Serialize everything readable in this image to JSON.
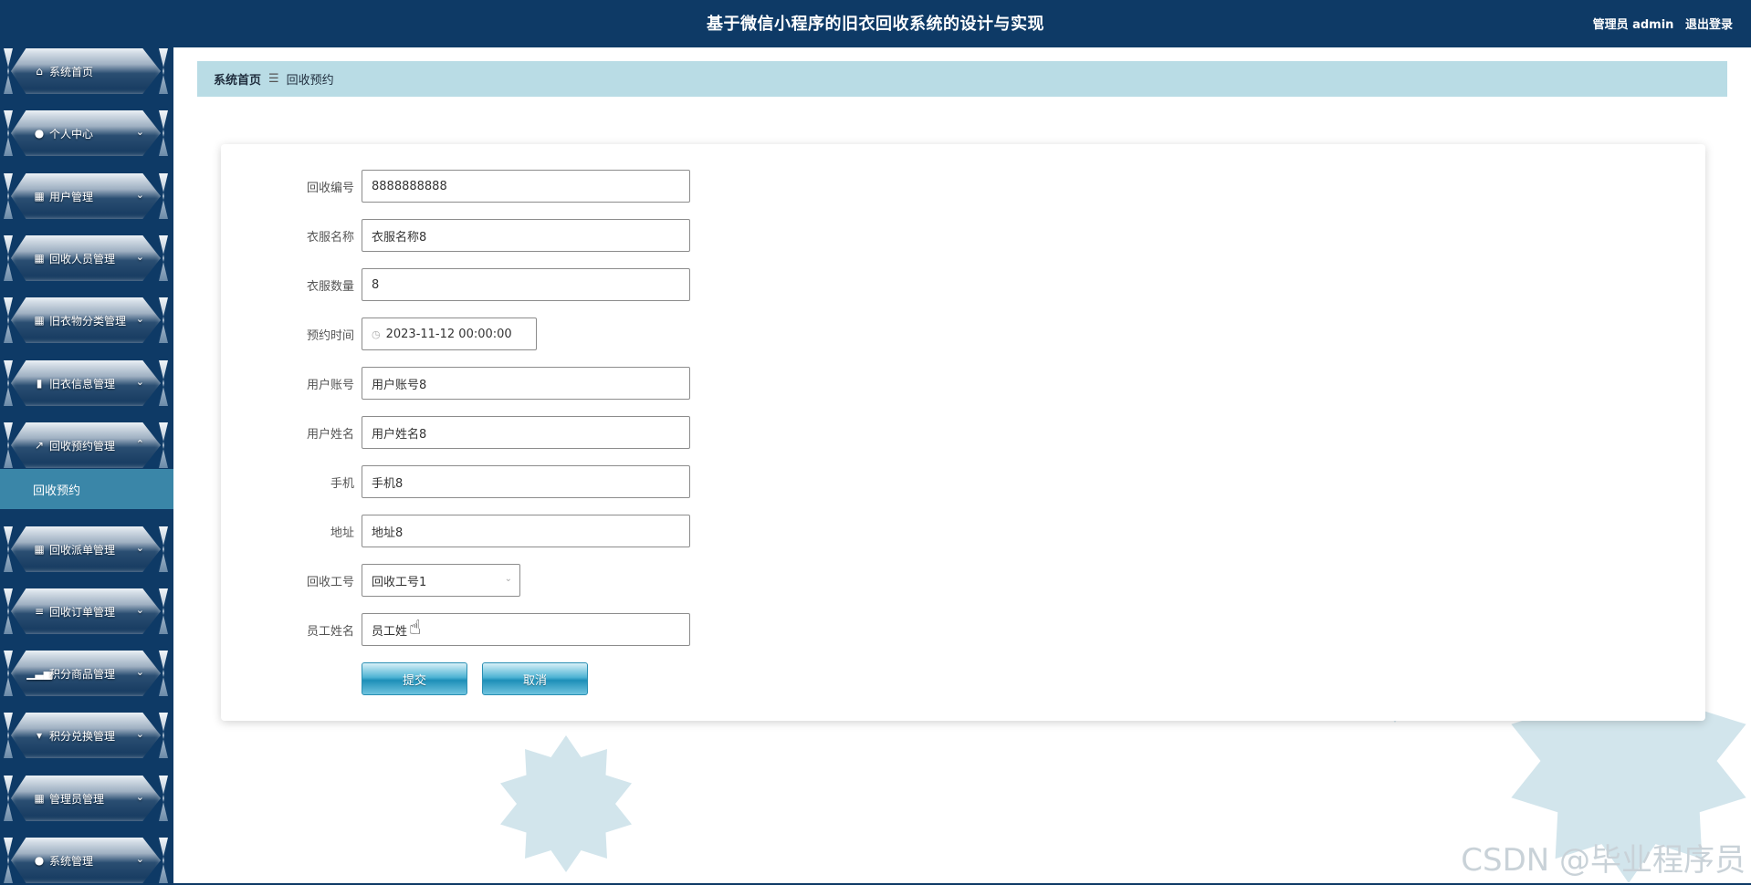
{
  "header": {
    "title": "基于微信小程序的旧衣回收系统的设计与实现",
    "user_label": "管理员 admin",
    "logout_label": "退出登录"
  },
  "sidebar": {
    "items": [
      {
        "label": "系统首页",
        "icon": "home-icon"
      },
      {
        "label": "个人中心",
        "icon": "user-icon"
      },
      {
        "label": "用户管理",
        "icon": "grid-icon"
      },
      {
        "label": "回收人员管理",
        "icon": "grid-icon"
      },
      {
        "label": "旧衣物分类管理",
        "icon": "grid-icon"
      },
      {
        "label": "旧衣信息管理",
        "icon": "chart-bar-icon"
      },
      {
        "label": "回收预约管理",
        "icon": "line-chart-icon"
      },
      {
        "label": "回收派单管理",
        "icon": "grid-icon"
      },
      {
        "label": "回收订单管理",
        "icon": "sliders-icon"
      },
      {
        "label": "积分商品管理",
        "icon": "bar-chart-icon"
      },
      {
        "label": "积分兑换管理",
        "icon": "cup-icon"
      },
      {
        "label": "管理员管理",
        "icon": "grid-icon"
      },
      {
        "label": "系统管理",
        "icon": "user-icon"
      }
    ],
    "active_sub": "回收预约"
  },
  "breadcrumb": {
    "home": "系统首页",
    "separator": "☰",
    "current": "回收预约"
  },
  "form": {
    "fields": [
      {
        "label": "回收编号",
        "value": "8888888888"
      },
      {
        "label": "衣服名称",
        "value": "衣服名称8"
      },
      {
        "label": "衣服数量",
        "value": "8"
      },
      {
        "label": "预约时间",
        "value": "2023-11-12 00:00:00"
      },
      {
        "label": "用户账号",
        "value": "用户账号8"
      },
      {
        "label": "用户姓名",
        "value": "用户姓名8"
      },
      {
        "label": "手机",
        "value": "手机8"
      },
      {
        "label": "地址",
        "value": "地址8"
      },
      {
        "label": "回收工号",
        "value": "回收工号1"
      },
      {
        "label": "员工姓名",
        "value": "员工姓"
      }
    ],
    "submit_label": "提交",
    "cancel_label": "取消"
  },
  "watermark": "CSDN @毕业程序员",
  "colors": {
    "header_bg": "#0e3a66",
    "breadcrumb_bg": "#b9dce5",
    "active_sub_bg": "#3a86a8",
    "button_blue": "#1d8fb8"
  }
}
